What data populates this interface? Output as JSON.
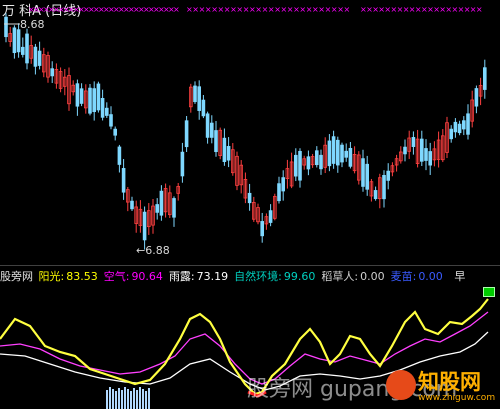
{
  "header": {
    "stock": "万 科A",
    "period": "(日线)"
  },
  "price": {
    "high_label": "8.68",
    "low_label": "←6.88"
  },
  "indicators": {
    "site": "股旁网",
    "items": [
      {
        "name": "阳光:",
        "value": "83.53",
        "name_color": "#ffff00",
        "value_color": "#ffff00"
      },
      {
        "name": "空气:",
        "value": "90.64",
        "name_color": "#ff00ff",
        "value_color": "#ff00ff"
      },
      {
        "name": "雨露:",
        "value": "73.19",
        "name_color": "#ffffff",
        "value_color": "#ffffff"
      },
      {
        "name": "自然环境:",
        "value": "99.60",
        "name_color": "#00d0c0",
        "value_color": "#00d0c0"
      },
      {
        "name": "稻草人:",
        "value": "0.00",
        "name_color": "#cfcfcf",
        "value_color": "#cfcfcf"
      },
      {
        "name": "麦苗:",
        "value": "0.00",
        "name_color": "#3a5bff",
        "value_color": "#3a5bff"
      }
    ],
    "trailing": "早"
  },
  "watermark": {
    "url": "股旁网 gupang.com",
    "logo_cn": "知股网",
    "logo_sub": "www.zhiguw.com"
  },
  "colors": {
    "up": "#ff4040",
    "down": "#7fd8ff",
    "marker": "#ff00ff",
    "line_sun": "#ffff40",
    "line_air": "#ff40ff",
    "line_dew": "#ffffff",
    "scarecrow_bars": "#b0d8ff"
  }
}
